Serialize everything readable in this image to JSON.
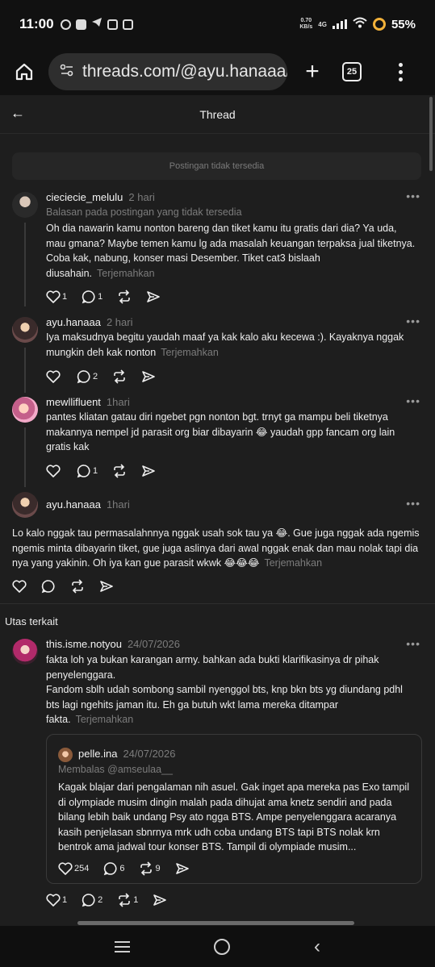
{
  "status": {
    "time": "11:00",
    "net_speed_value": "0.70",
    "net_speed_unit": "KB/s",
    "network": "4G",
    "battery": "55%"
  },
  "browser": {
    "url": "threads.com/@ayu.hanaaa/",
    "tab_count": "25"
  },
  "header": {
    "title": "Thread"
  },
  "unavailable": "Postingan tidak tersedia",
  "translate_label": "Terjemahkan",
  "posts": [
    {
      "username": "cieciecie_melulu",
      "time": "2 hari",
      "reply_note": "Balasan pada postingan yang tidak tersedia",
      "text": "Oh dia nawarin kamu nonton bareng dan tiket kamu itu gratis dari dia? Ya uda, mau gmana? Maybe temen kamu lg ada masalah keuangan terpaksa jual tiketnya. Coba kak, nabung, konser masi Desember. Tiket cat3 bislaah diusahain.",
      "likes": "1",
      "replies": "1",
      "reposts": ""
    },
    {
      "username": "ayu.hanaaa",
      "time": "2 hari",
      "text": "Iya maksudnya begitu yaudah maaf ya kak kalo aku kecewa :). Kayaknya nggak mungkin deh kak nonton",
      "likes": "",
      "replies": "2",
      "reposts": ""
    },
    {
      "username": "mewllifluent",
      "time": "1hari",
      "text": "pantes kliatan gatau diri ngebet pgn nonton bgt. trnyt ga mampu beli tiketnya makannya nempel jd parasit org biar dibayarin 😂 yaudah gpp fancam org lain gratis kak",
      "likes": "",
      "replies": "1",
      "reposts": ""
    },
    {
      "username": "ayu.hanaaa",
      "time": "1hari",
      "text": "Lo kalo nggak tau permasalahnnya nggak usah sok tau ya 😂. Gue juga nggak ada ngemis ngemis minta dibayarin tiket, gue juga aslinya dari awal nggak enak dan mau nolak tapi dia nya yang yakinin. Oh iya kan gue parasit wkwk 😂😂😂",
      "likes": "",
      "replies": "",
      "reposts": ""
    }
  ],
  "related": {
    "title": "Utas terkait",
    "post": {
      "username": "this.isme.notyou",
      "time": "24/07/2026",
      "text_line1": "fakta loh ya bukan karangan army. bahkan ada bukti klarifikasinya dr pihak penyelenggara.",
      "text_line2": "Fandom sblh udah sombong sambil nyenggol bts, knp bkn bts yg diundang pdhl bts lagi ngehits jaman itu. Eh ga butuh wkt lama mereka ditampar fakta.",
      "likes": "1",
      "replies": "2",
      "reposts": "1"
    },
    "quote": {
      "username": "pelle.ina",
      "time": "24/07/2026",
      "reply_note": "Membalas @amseulaa__",
      "text": "Kagak blajar dari pengalaman nih asuel. Gak inget apa mereka pas Exo tampil di olympiade musim dingin malah pada dihujat ama knetz sendiri and pada bilang lebih baik undang Psy ato ngga BTS. Ampe penyelenggara acaranya kasih penjelasan sbnrnya mrk udh coba undang BTS tapi BTS nolak krn bentrok ama jadwal tour konser BTS. Tampil di olympiade musim...",
      "likes": "254",
      "replies": "6",
      "reposts": "9"
    }
  }
}
